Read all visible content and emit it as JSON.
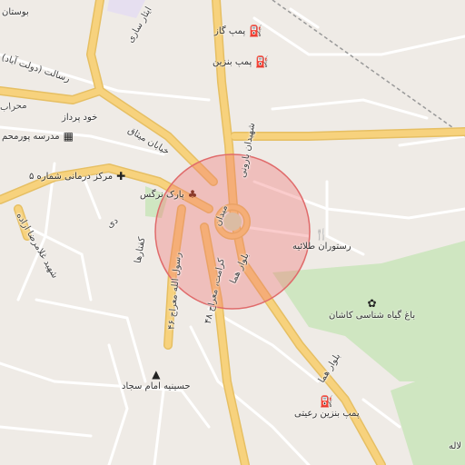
{
  "map": {
    "highlight_color": "#e06b6b",
    "park_color": "#cfe6c1",
    "road_color": "#f7d27d",
    "minor_road_color": "#ffffff"
  },
  "places": {
    "bostan": "بوستان",
    "pump_gas": "پمپ گاز",
    "pump_benzin": "پمپ بنزین",
    "khod_pardaz": "خود پرداز",
    "madrese": "مدرسه پورمحم",
    "markaz": "مرکز درمانی شماره ۵",
    "park_narges": "پارک نرگس",
    "restoran": "رستوران طلائیه",
    "bagh": "باغ گیاه شناسی کاشان",
    "hosseinie": "حسینیه امام سجاد",
    "pump_reyni": "پمپ بنزین رعیتی",
    "lale": "لاله"
  },
  "roads": {
    "shahidan_baroun": "شهیدان بارونی",
    "bolvar_homa_1": "بلوار هما",
    "bolvar_homa_2": "بلوار هما",
    "meydan": "میدان",
    "khiaban_misaq": "خیابان میثاق",
    "resalat": "رسالت (دولت آباد)",
    "shahid_ghaemi": "شهید غلامرضا اراده",
    "ostad": "دی",
    "karamat": "کرامت، معراج ۴۸",
    "rasool": "رسول الله معراج ۴۶",
    "kaftar": "کفتارها",
    "mehrab": "محراب",
    "sahl": "ایثار ساری"
  }
}
